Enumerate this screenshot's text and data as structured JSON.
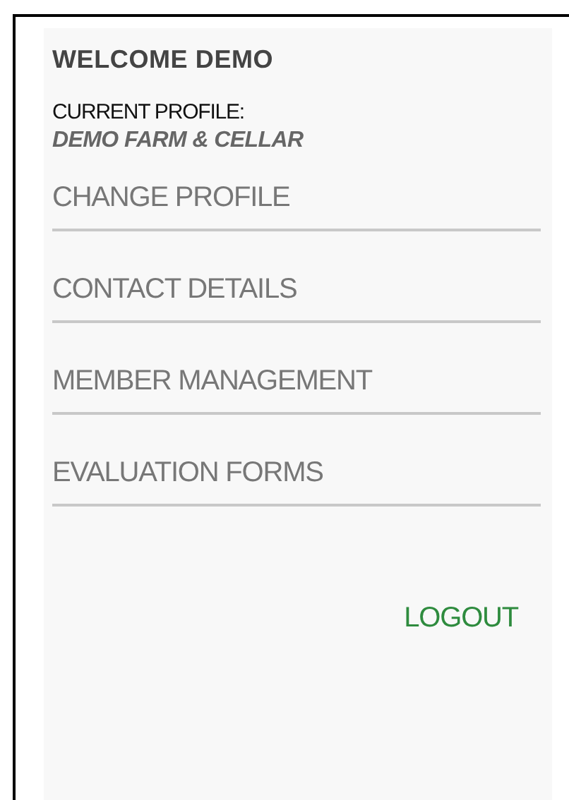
{
  "welcome": "WELCOME DEMO",
  "profile": {
    "label": "CURRENT PROFILE:",
    "name": "DEMO FARM & CELLAR"
  },
  "menu": [
    {
      "label": "CHANGE PROFILE"
    },
    {
      "label": "CONTACT DETAILS"
    },
    {
      "label": "MEMBER MANAGEMENT"
    },
    {
      "label": "EVALUATION FORMS"
    }
  ],
  "logout": "LOGOUT"
}
